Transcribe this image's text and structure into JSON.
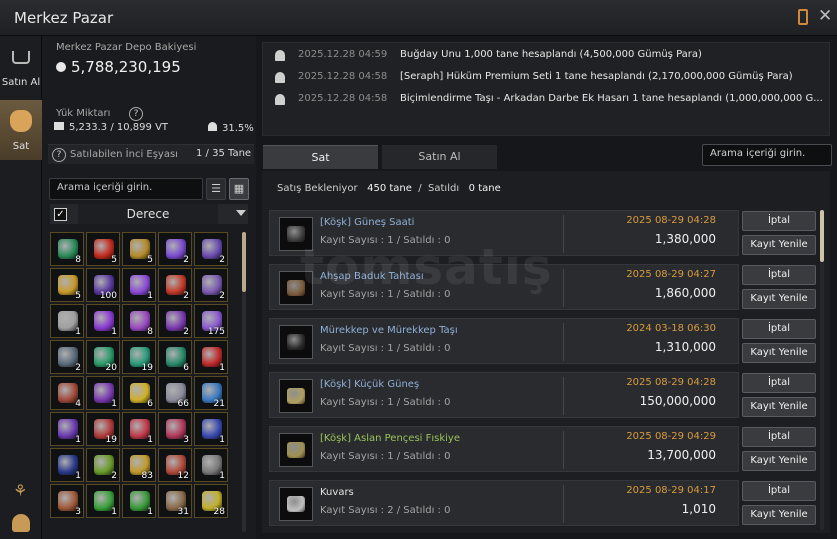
{
  "window": {
    "title": "Merkez Pazar"
  },
  "sidebar": {
    "tabs": [
      {
        "label": "Satın Al",
        "icon": "cart-icon"
      },
      {
        "label": "Sat",
        "icon": "bag-icon"
      }
    ]
  },
  "wallet": {
    "label": "Merkez Pazar Depo Bakiyesi",
    "amount": "5,788,230,195"
  },
  "weight": {
    "label": "Yük Miktarı",
    "value": "5,233.3 / 10,899 VT",
    "percent": "31.5%"
  },
  "pearl": {
    "label": "Satılabilen İnci Eşyası",
    "value": "1 / 35 Tane"
  },
  "search_left": {
    "placeholder": "Arama içeriği girin."
  },
  "sort": {
    "label": "Derece"
  },
  "inventory": [
    {
      "count": "8",
      "color": "#2a8a5a"
    },
    {
      "count": "5",
      "color": "#c22a1f"
    },
    {
      "count": "5",
      "color": "#b48a2a"
    },
    {
      "count": "2",
      "color": "#7a4bd0"
    },
    {
      "count": "2",
      "color": "#6a4bb0"
    },
    {
      "count": "5",
      "color": "#c79a2a"
    },
    {
      "count": "100",
      "color": "#5b3aa0"
    },
    {
      "count": "1",
      "color": "#8a4ad6"
    },
    {
      "count": "2",
      "color": "#c23a2a"
    },
    {
      "count": "2",
      "color": "#7a5ab0"
    },
    {
      "count": "1",
      "color": "#a0a0a0"
    },
    {
      "count": "1",
      "color": "#8a3ad0"
    },
    {
      "count": "8",
      "color": "#9a4ac0"
    },
    {
      "count": "2",
      "color": "#7a3ab0"
    },
    {
      "count": "175",
      "color": "#8a5ad0"
    },
    {
      "count": "2",
      "color": "#5a6a7a"
    },
    {
      "count": "20",
      "color": "#2a9a6a"
    },
    {
      "count": "19",
      "color": "#2a9a7a"
    },
    {
      "count": "6",
      "color": "#2a8a6a"
    },
    {
      "count": "1",
      "color": "#c02a2a"
    },
    {
      "count": "4",
      "color": "#a04a3a"
    },
    {
      "count": "1",
      "color": "#7a3ab0"
    },
    {
      "count": "6",
      "color": "#d0b02a"
    },
    {
      "count": "66",
      "color": "#8a8a9a"
    },
    {
      "count": "21",
      "color": "#3a7ac0"
    },
    {
      "count": "1",
      "color": "#6a3ab0"
    },
    {
      "count": "19",
      "color": "#b03a3a"
    },
    {
      "count": "1",
      "color": "#c03a4a"
    },
    {
      "count": "3",
      "color": "#b03a5a"
    },
    {
      "count": "1",
      "color": "#3a4ab0"
    },
    {
      "count": "1",
      "color": "#2a3a8a"
    },
    {
      "count": "2",
      "color": "#6a9a2a"
    },
    {
      "count": "83",
      "color": "#c09a2a"
    },
    {
      "count": "12",
      "color": "#b04a3a"
    },
    {
      "count": "1",
      "color": "#7a7a7a"
    },
    {
      "count": "3",
      "color": "#a05a3a"
    },
    {
      "count": "1",
      "color": "#3aa03a"
    },
    {
      "count": "1",
      "color": "#3a9a3a"
    },
    {
      "count": "31",
      "color": "#8a6a4a"
    },
    {
      "count": "28",
      "color": "#c0b02a"
    }
  ],
  "notices": [
    {
      "date": "2025.12.28 04:59",
      "text": "Buğday Unu 1,000 tane hesaplandı (4,500,000 Gümüş Para)"
    },
    {
      "date": "2025.12.28 04:58",
      "text": "[Seraph] Hüküm Premium Seti 1 tane hesaplandı (2,170,000,000 Gümüş Para)"
    },
    {
      "date": "2025.12.28 04:58",
      "text": "Biçimlendirme Taşı - Arkadan Darbe Ek Hasarı 1 tane hesaplandı (1,000,000,000 G..."
    }
  ],
  "tabs": {
    "sell": "Sat",
    "buy": "Satın Al"
  },
  "search_right": {
    "placeholder": "Arama içeriği girin."
  },
  "status": {
    "pending_label": "Satış Bekleniyor",
    "pending": "450 tane",
    "sep": "/",
    "sold_label": "Satıldı",
    "sold": "0 tane"
  },
  "buttons": {
    "cancel": "İptal",
    "renew": "Kayıt Yenile"
  },
  "listings": [
    {
      "name": "[Köşk] Güneş Saati",
      "grade": "blue",
      "sub": "Kayıt Sayısı : 1 / Satıldı : 0",
      "date": "2025 08-29 04:28",
      "price": "1,380,000",
      "icon_color": "#3a3a3a"
    },
    {
      "name": "Ahşap Baduk Tahtası",
      "grade": "blue",
      "sub": "Kayıt Sayısı : 1 / Satıldı : 0",
      "date": "2025 08-29 04:27",
      "price": "1,860,000",
      "icon_color": "#7a5a3a"
    },
    {
      "name": "Mürekkep ve Mürekkep Taşı",
      "grade": "blue",
      "sub": "Kayıt Sayısı : 1 / Satıldı : 0",
      "date": "2024 03-18 06:30",
      "price": "1,310,000",
      "icon_color": "#2a2a2a"
    },
    {
      "name": "[Köşk] Küçük Güneş",
      "grade": "blue",
      "sub": "Kayıt Sayısı : 1 / Satıldı : 0",
      "date": "2025 08-29 04:28",
      "price": "150,000,000",
      "icon_color": "#b0a060"
    },
    {
      "name": "[Köşk] Aslan Pençesi Fıskiye",
      "grade": "green",
      "sub": "Kayıt Sayısı : 1 / Satıldı : 0",
      "date": "2025 08-29 04:29",
      "price": "13,700,000",
      "icon_color": "#a09050"
    },
    {
      "name": "Kuvars",
      "grade": "white",
      "sub": "Kayıt Sayısı : 2 / Satıldı : 0",
      "date": "2025 08-29 04:17",
      "price": "1,010",
      "icon_color": "#c0c0c0"
    }
  ],
  "watermark": "tomsatış"
}
